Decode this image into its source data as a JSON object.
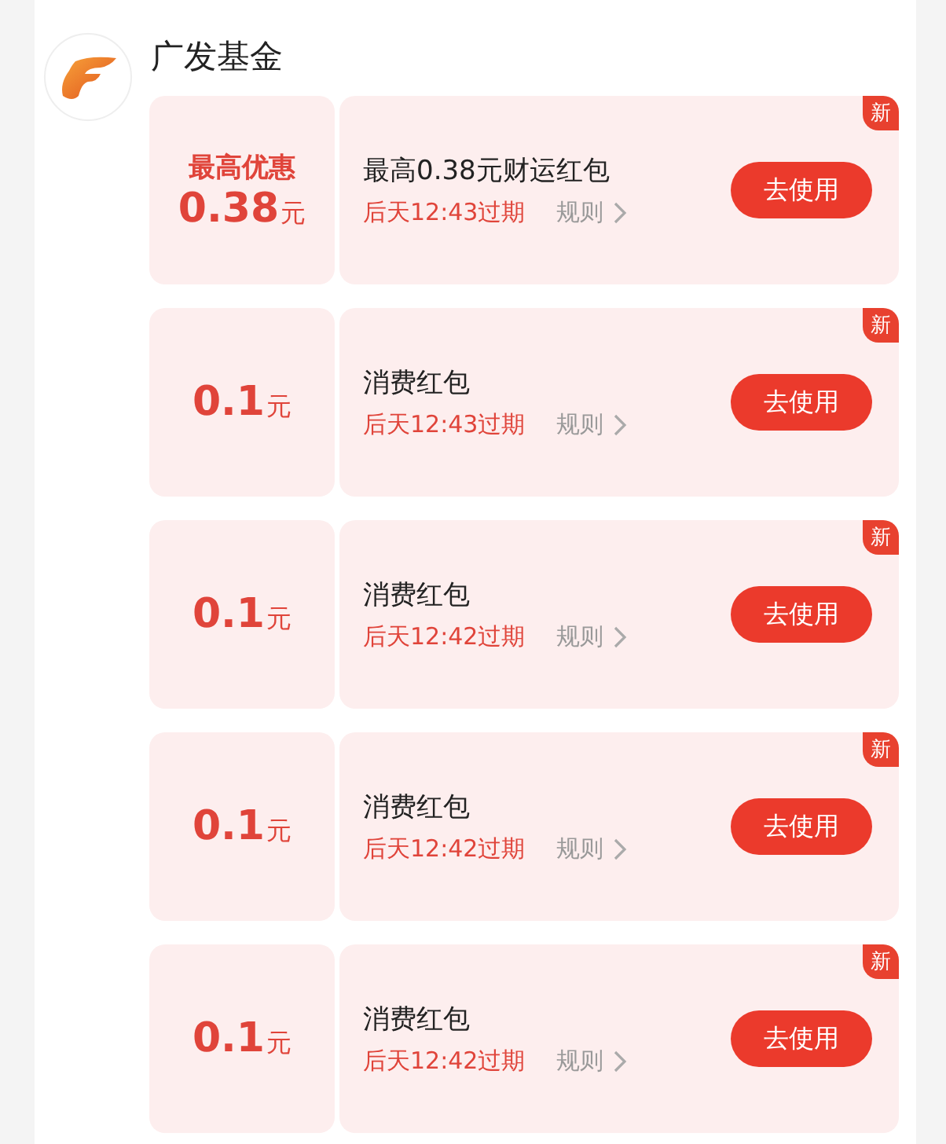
{
  "merchant": {
    "name": "广发基金"
  },
  "coupons": [
    {
      "label": "最高优惠",
      "amount": "0.38",
      "unit": "元",
      "title": "最高0.38元财运红包",
      "expiry": "后天12:43过期",
      "rules": "规则",
      "button": "去使用",
      "badge": "新"
    },
    {
      "amount": "0.1",
      "unit": "元",
      "title": "消费红包",
      "expiry": "后天12:43过期",
      "rules": "规则",
      "button": "去使用",
      "badge": "新"
    },
    {
      "amount": "0.1",
      "unit": "元",
      "title": "消费红包",
      "expiry": "后天12:42过期",
      "rules": "规则",
      "button": "去使用",
      "badge": "新"
    },
    {
      "amount": "0.1",
      "unit": "元",
      "title": "消费红包",
      "expiry": "后天12:42过期",
      "rules": "规则",
      "button": "去使用",
      "badge": "新"
    },
    {
      "amount": "0.1",
      "unit": "元",
      "title": "消费红包",
      "expiry": "后天12:42过期",
      "rules": "规则",
      "button": "去使用",
      "badge": "新"
    }
  ]
}
